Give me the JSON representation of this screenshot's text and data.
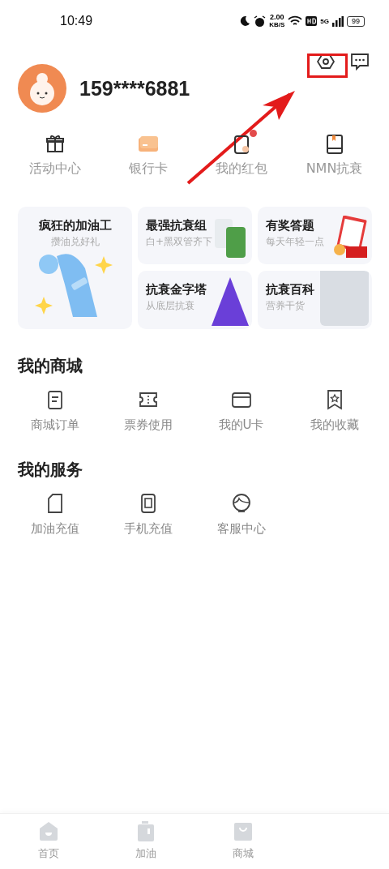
{
  "status_bar": {
    "time": "10:49",
    "speed": "2.00",
    "speed_unit": "KB/S",
    "network": "5G",
    "battery": "99"
  },
  "profile": {
    "phone": "159****6881"
  },
  "quick_links": [
    {
      "label": "活动中心",
      "dot": false
    },
    {
      "label": "银行卡",
      "dot": false
    },
    {
      "label": "我的红包",
      "dot": true
    },
    {
      "label": "NMN抗衰",
      "dot": false
    }
  ],
  "promo_cards": [
    {
      "title": "疯狂的加油工",
      "subtitle": "攒油兑好礼"
    },
    {
      "title": "最强抗衰组",
      "subtitle": "白+黑双管齐下"
    },
    {
      "title": "有奖答题",
      "subtitle": "每天年轻一点"
    },
    {
      "title": "抗衰金字塔",
      "subtitle": "从底层抗衰"
    },
    {
      "title": "抗衰百科",
      "subtitle": "营养干货"
    }
  ],
  "sections": [
    {
      "title": "我的商城",
      "items": [
        "商城订单",
        "票券使用",
        "我的U卡",
        "我的收藏"
      ]
    },
    {
      "title": "我的服务",
      "items": [
        "加油充值",
        "手机充值",
        "客服中心"
      ]
    }
  ],
  "bottom_nav": [
    {
      "label": "首页",
      "selected": false
    },
    {
      "label": "加油",
      "selected": false
    },
    {
      "label": "商城",
      "selected": false
    }
  ]
}
